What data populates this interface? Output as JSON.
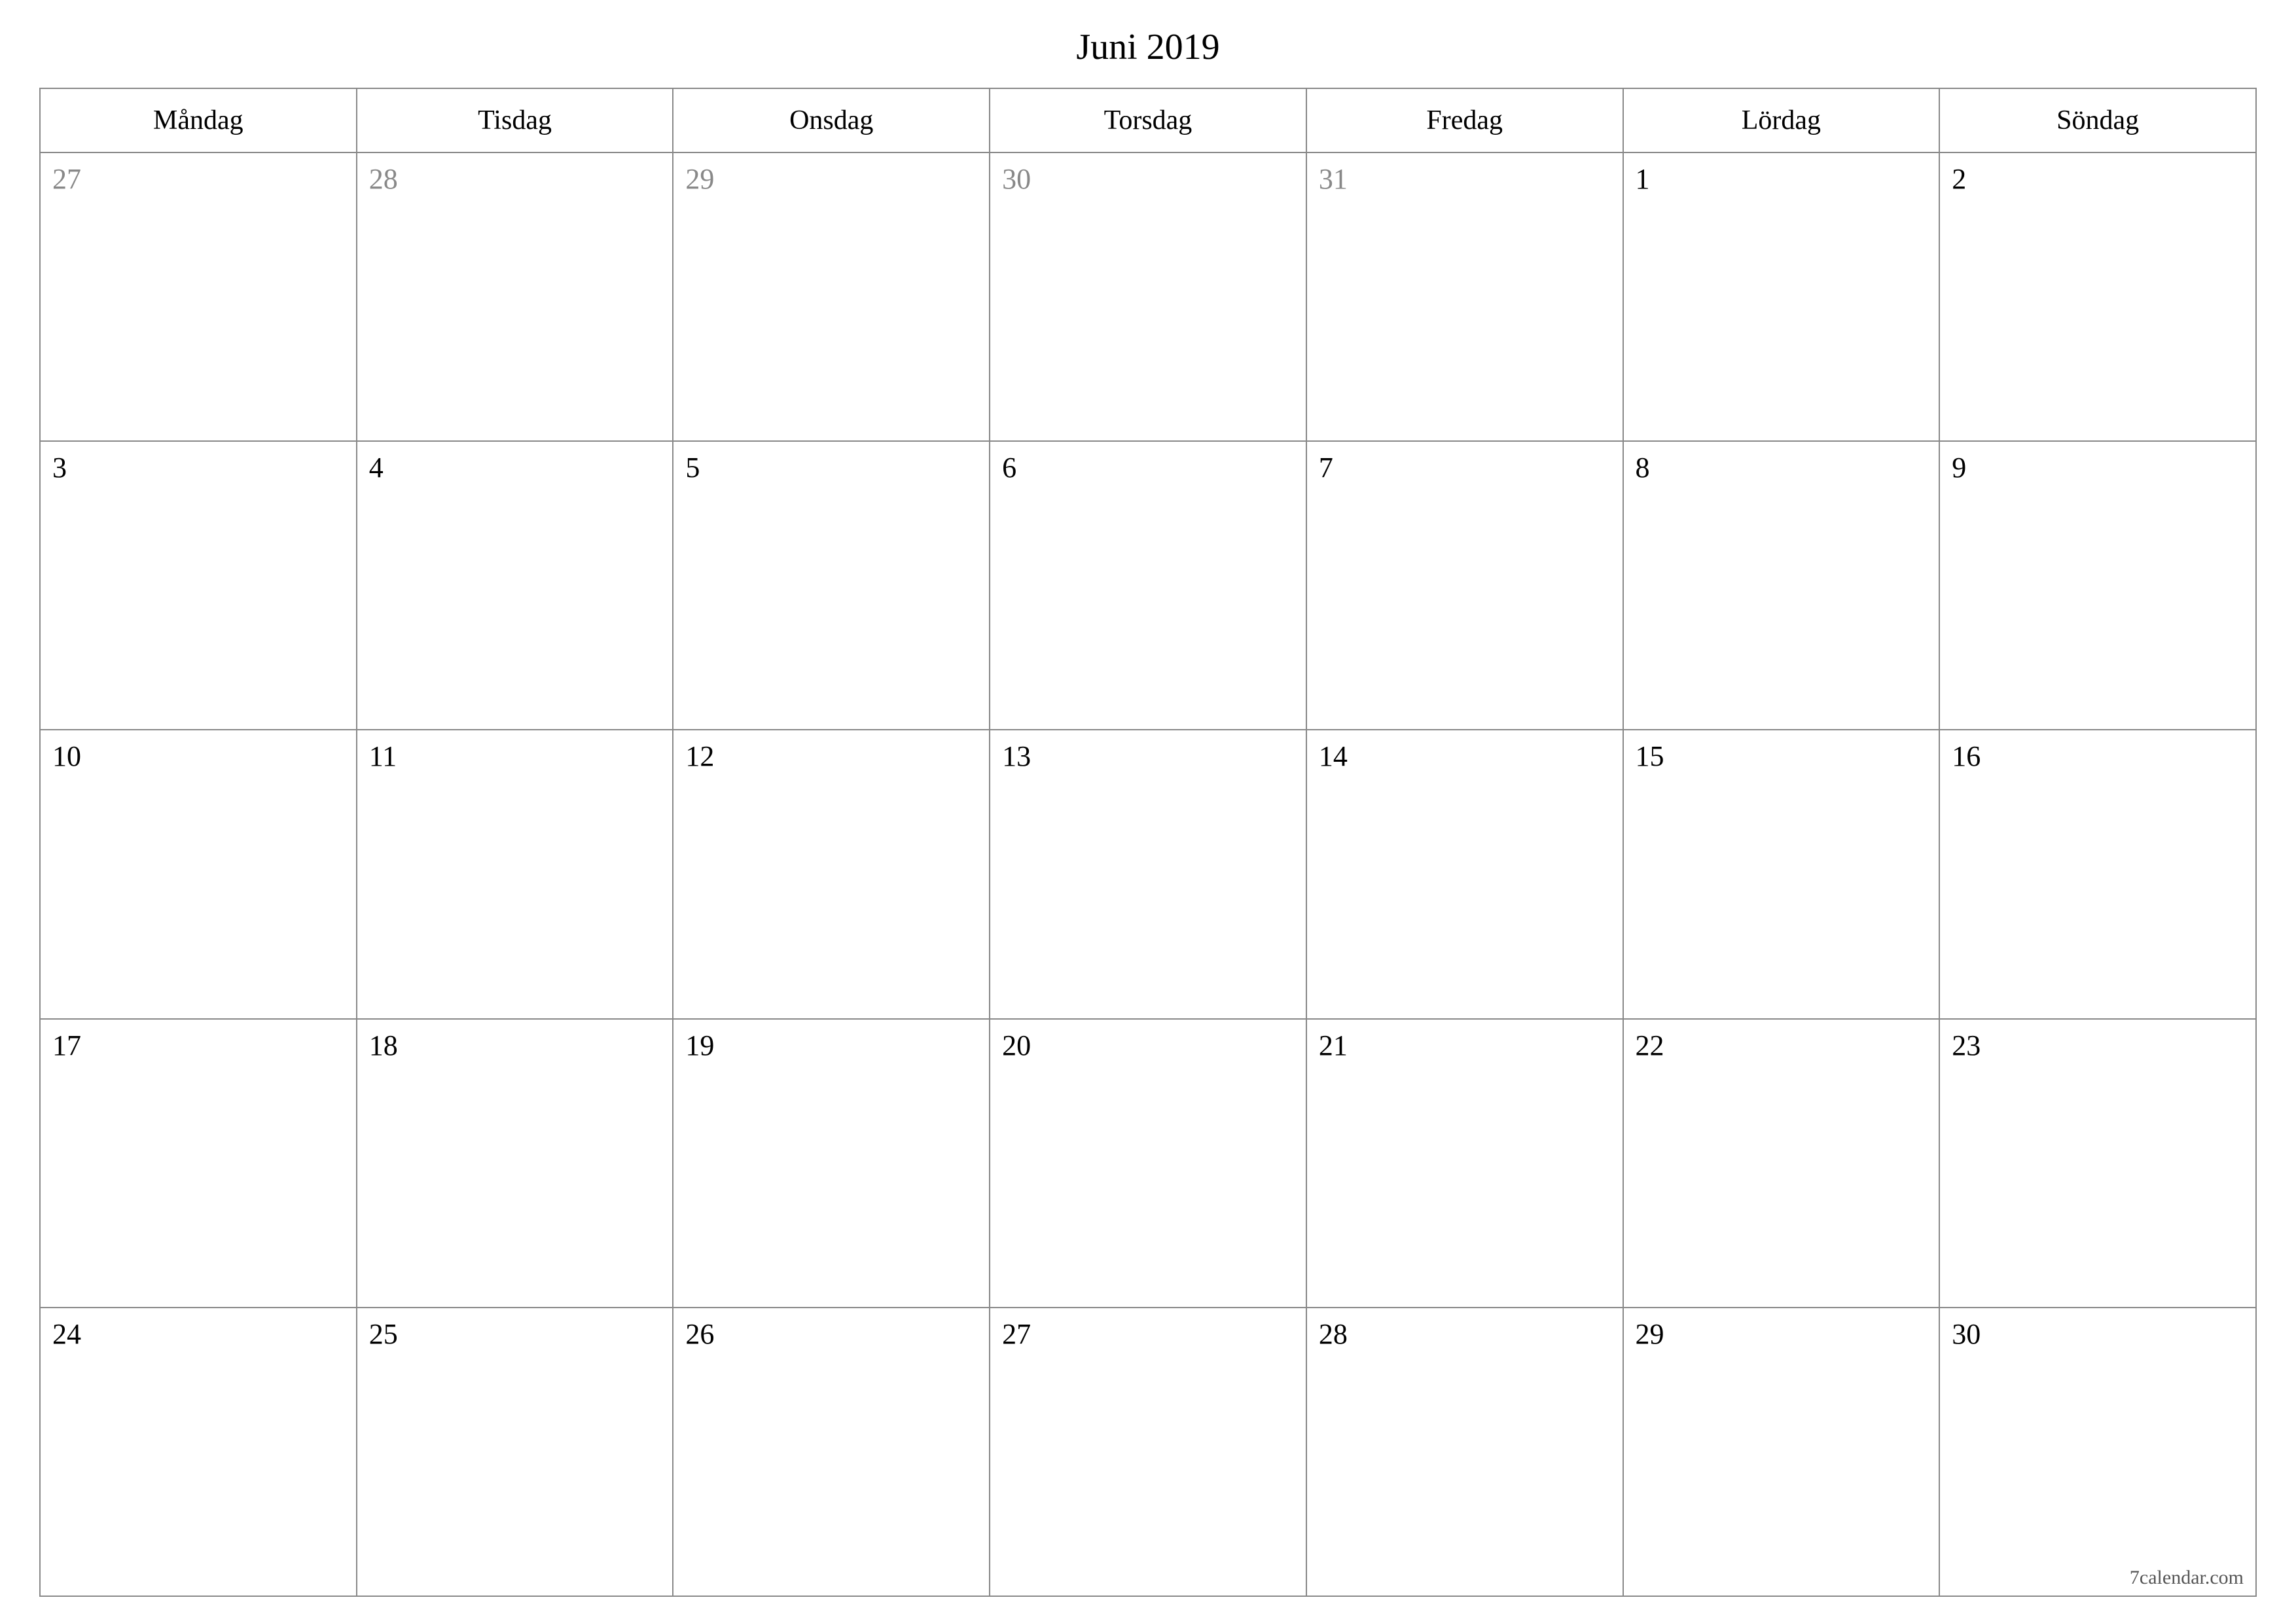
{
  "title": "Juni 2019",
  "weekday_headers": [
    "Måndag",
    "Tisdag",
    "Onsdag",
    "Torsdag",
    "Fredag",
    "Lördag",
    "Söndag"
  ],
  "weeks": [
    [
      {
        "day": "27",
        "other_month": true
      },
      {
        "day": "28",
        "other_month": true
      },
      {
        "day": "29",
        "other_month": true
      },
      {
        "day": "30",
        "other_month": true
      },
      {
        "day": "31",
        "other_month": true
      },
      {
        "day": "1",
        "other_month": false
      },
      {
        "day": "2",
        "other_month": false
      }
    ],
    [
      {
        "day": "3",
        "other_month": false
      },
      {
        "day": "4",
        "other_month": false
      },
      {
        "day": "5",
        "other_month": false
      },
      {
        "day": "6",
        "other_month": false
      },
      {
        "day": "7",
        "other_month": false
      },
      {
        "day": "8",
        "other_month": false
      },
      {
        "day": "9",
        "other_month": false
      }
    ],
    [
      {
        "day": "10",
        "other_month": false
      },
      {
        "day": "11",
        "other_month": false
      },
      {
        "day": "12",
        "other_month": false
      },
      {
        "day": "13",
        "other_month": false
      },
      {
        "day": "14",
        "other_month": false
      },
      {
        "day": "15",
        "other_month": false
      },
      {
        "day": "16",
        "other_month": false
      }
    ],
    [
      {
        "day": "17",
        "other_month": false
      },
      {
        "day": "18",
        "other_month": false
      },
      {
        "day": "19",
        "other_month": false
      },
      {
        "day": "20",
        "other_month": false
      },
      {
        "day": "21",
        "other_month": false
      },
      {
        "day": "22",
        "other_month": false
      },
      {
        "day": "23",
        "other_month": false
      }
    ],
    [
      {
        "day": "24",
        "other_month": false
      },
      {
        "day": "25",
        "other_month": false
      },
      {
        "day": "26",
        "other_month": false
      },
      {
        "day": "27",
        "other_month": false
      },
      {
        "day": "28",
        "other_month": false
      },
      {
        "day": "29",
        "other_month": false
      },
      {
        "day": "30",
        "other_month": false
      }
    ]
  ],
  "footer": "7calendar.com"
}
